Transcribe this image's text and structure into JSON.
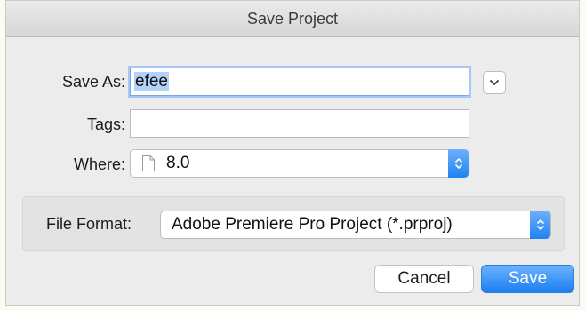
{
  "dialog": {
    "title": "Save Project"
  },
  "save_as": {
    "label": "Save As:",
    "value": "efee"
  },
  "tags": {
    "label": "Tags:",
    "value": ""
  },
  "where": {
    "label": "Where:",
    "value": "8.0",
    "icon": "document-icon"
  },
  "file_format": {
    "label": "File Format:",
    "value": "Adobe Premiere Pro Project (*.prproj)"
  },
  "buttons": {
    "cancel_label": "Cancel",
    "save_label": "Save"
  },
  "colors": {
    "accent": "#1f82f2",
    "focus_ring": "#a7c8f3",
    "selection": "#b3d2f7"
  }
}
